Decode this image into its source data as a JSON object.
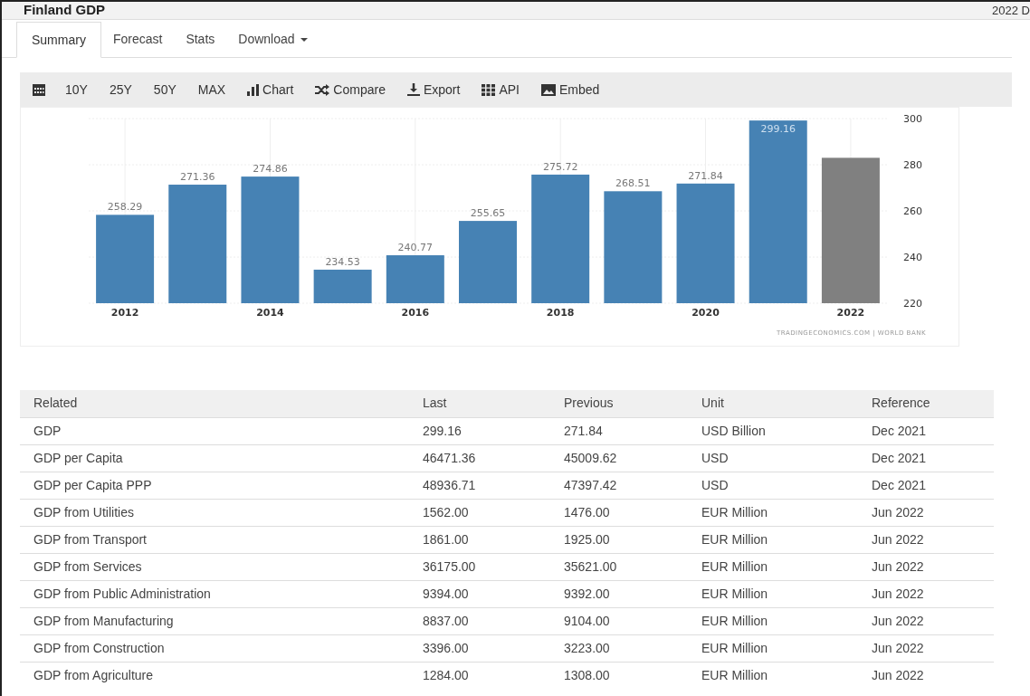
{
  "header": {
    "title": "Finland GDP",
    "right_text": "2022 D"
  },
  "tabs": [
    {
      "label": "Summary",
      "selected": true
    },
    {
      "label": "Forecast",
      "selected": false
    },
    {
      "label": "Stats",
      "selected": false
    },
    {
      "label": "Download",
      "selected": false,
      "dropdown": true
    }
  ],
  "toolbar": [
    {
      "kind": "calendar"
    },
    {
      "kind": "text",
      "label": "10Y"
    },
    {
      "kind": "text",
      "label": "25Y"
    },
    {
      "kind": "text",
      "label": "50Y"
    },
    {
      "kind": "text",
      "label": "MAX"
    },
    {
      "kind": "chart",
      "label": "Chart"
    },
    {
      "kind": "compare",
      "label": "Compare"
    },
    {
      "kind": "export",
      "label": "Export"
    },
    {
      "kind": "api",
      "label": "API"
    },
    {
      "kind": "embed",
      "label": "Embed"
    }
  ],
  "chart": {
    "source": "TRADINGECONOMICS.COM | WORLD BANK",
    "chart_data": {
      "type": "bar",
      "x": [
        2012,
        2013,
        2014,
        2015,
        2016,
        2017,
        2018,
        2019,
        2020,
        2021,
        2022
      ],
      "series": [
        {
          "color": "#4682b4",
          "values": [
            258.29,
            271.36,
            274.86,
            234.53,
            240.77,
            255.65,
            275.72,
            268.51,
            271.84,
            299.16,
            null
          ]
        },
        {
          "color": "#808080",
          "values": [
            null,
            null,
            null,
            null,
            null,
            null,
            null,
            null,
            null,
            null,
            283
          ]
        }
      ],
      "value_labels": [
        "258.29",
        "271.36",
        "274.86",
        "234.53",
        "240.77",
        "255.65",
        "275.72",
        "268.51",
        "271.84",
        "299.16",
        null
      ],
      "xticks": [
        2012,
        2014,
        2016,
        2018,
        2020,
        2022
      ],
      "xlim": [
        2011.5,
        2022.5
      ],
      "grid": true,
      "ylim": [
        220,
        300
      ],
      "yticks": [
        220,
        240,
        260,
        280,
        300
      ]
    }
  },
  "table": {
    "columns": [
      "Related",
      "Last",
      "Previous",
      "Unit",
      "Reference"
    ],
    "rows": [
      [
        "GDP",
        "299.16",
        "271.84",
        "USD Billion",
        "Dec 2021"
      ],
      [
        "GDP per Capita",
        "46471.36",
        "45009.62",
        "USD",
        "Dec 2021"
      ],
      [
        "GDP per Capita PPP",
        "48936.71",
        "47397.42",
        "USD",
        "Dec 2021"
      ],
      [
        "GDP from Utilities",
        "1562.00",
        "1476.00",
        "EUR Million",
        "Jun 2022"
      ],
      [
        "GDP from Transport",
        "1861.00",
        "1925.00",
        "EUR Million",
        "Jun 2022"
      ],
      [
        "GDP from Services",
        "36175.00",
        "35621.00",
        "EUR Million",
        "Jun 2022"
      ],
      [
        "GDP from Public Administration",
        "9394.00",
        "9392.00",
        "EUR Million",
        "Jun 2022"
      ],
      [
        "GDP from Manufacturing",
        "8837.00",
        "9104.00",
        "EUR Million",
        "Jun 2022"
      ],
      [
        "GDP from Construction",
        "3396.00",
        "3223.00",
        "EUR Million",
        "Jun 2022"
      ],
      [
        "GDP from Agriculture",
        "1284.00",
        "1308.00",
        "EUR Million",
        "Jun 2022"
      ]
    ]
  }
}
